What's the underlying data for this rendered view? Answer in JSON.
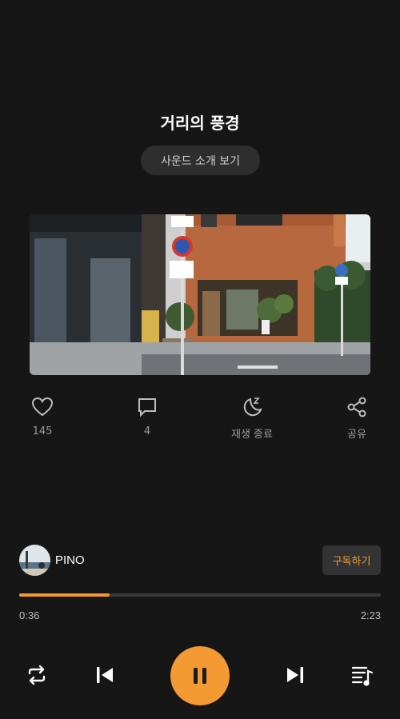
{
  "track": {
    "title": "거리의 풍경"
  },
  "intro_button": {
    "label": "사운드 소개 보기"
  },
  "cover": {
    "icon": "street-photo"
  },
  "actions": {
    "like": {
      "icon": "heart-icon",
      "label": "145"
    },
    "comment": {
      "icon": "comment-icon",
      "label": "4"
    },
    "sleep": {
      "icon": "moon-zzz-icon",
      "label": "재생 종료"
    },
    "share": {
      "icon": "share-icon",
      "label": "공유"
    }
  },
  "artist": {
    "name": "PINO",
    "subscribe_label": "구독하기"
  },
  "player": {
    "elapsed": "0:36",
    "duration": "2:23",
    "progress": 0.25,
    "state": "playing",
    "accent": "#f49a33"
  },
  "controls": [
    "repeat-icon",
    "previous-icon",
    "pause-icon",
    "next-icon",
    "playlist-icon"
  ]
}
